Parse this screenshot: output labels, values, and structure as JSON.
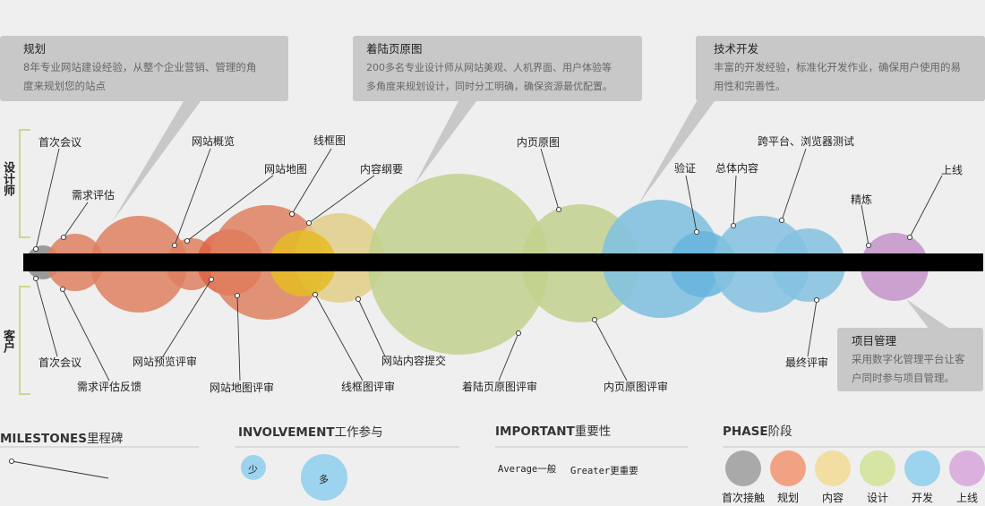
{
  "callouts": {
    "planning": {
      "title": "规划",
      "desc": [
        "8年专业网站建设经验，从整个企业营销、管理的角",
        "度来规划您的站点"
      ]
    },
    "landing": {
      "title": "着陆页原图",
      "desc": [
        "200多名专业设计师从网站美观、人机界面、用户体验等",
        "多角度来规划设计，同时分工明确，确保资源最优配置。"
      ]
    },
    "tech": {
      "title": "技术开发",
      "desc": [
        "丰富的开发经验，标准化开发作业，确保用户使用的易",
        "用性和完善性。"
      ]
    },
    "pm": {
      "title": "项目管理",
      "desc": [
        "采用数字化管理平台让客",
        "户同时参与项目管理。"
      ]
    }
  },
  "sides": {
    "designer": "设计师",
    "client": "客户"
  },
  "labels": {
    "first_meeting_top": "首次会议",
    "req_eval": "需求评估",
    "site_overview": "网站概览",
    "site_map": "网站地图",
    "wireframe": "线框图",
    "content_outline": "内容纲要",
    "inner_page": "内页原图",
    "verify": "验证",
    "overall_content": "总体内容",
    "cross_platform": "跨平台、浏览器测试",
    "refine": "精炼",
    "launch": "上线",
    "first_meeting_bottom": "首次会议",
    "req_feedback": "需求评估反馈",
    "site_preview_review": "网站预览评审",
    "site_map_review": "网站地图评审",
    "wireframe_review": "线框图评审",
    "content_submit": "网站内容提交",
    "landing_review": "着陆页原图评审",
    "inner_review": "内页原图评审",
    "final_review": "最终评审"
  },
  "legend": {
    "milestones": {
      "en": "MILESTONES",
      "cn": "里程碑"
    },
    "involvement": {
      "en": "INVOLVEMENT",
      "cn": "工作参与",
      "less": "少",
      "more": "多"
    },
    "importance": {
      "en": "IMPORTANT",
      "cn": "重要性",
      "average": "Average一般",
      "greater": "Greater更重要"
    },
    "phase": {
      "en": "PHASE",
      "cn": "阶段",
      "items": [
        {
          "label": "首次接触",
          "color": "#a9a9a9"
        },
        {
          "label": "规划",
          "color": "#f0a283"
        },
        {
          "label": "内容",
          "color": "#f1dea0"
        },
        {
          "label": "设计",
          "color": "#d6e4a4"
        },
        {
          "label": "开发",
          "color": "#9cd3ee"
        },
        {
          "label": "上线",
          "color": "#dcb0de"
        }
      ]
    }
  },
  "colors": {
    "gray": "#9a9a9a",
    "planning": "#ee8a66",
    "planning_dark": "#f07050",
    "content": "#f2dc90",
    "content_strong": "#f6cc30",
    "design": "#cfe199",
    "dev": "#8dcff0",
    "dev_dark": "#6cc3ee",
    "launch": "#d7a8dc",
    "timeline": "#000000",
    "bracket": "#c9d98a"
  }
}
